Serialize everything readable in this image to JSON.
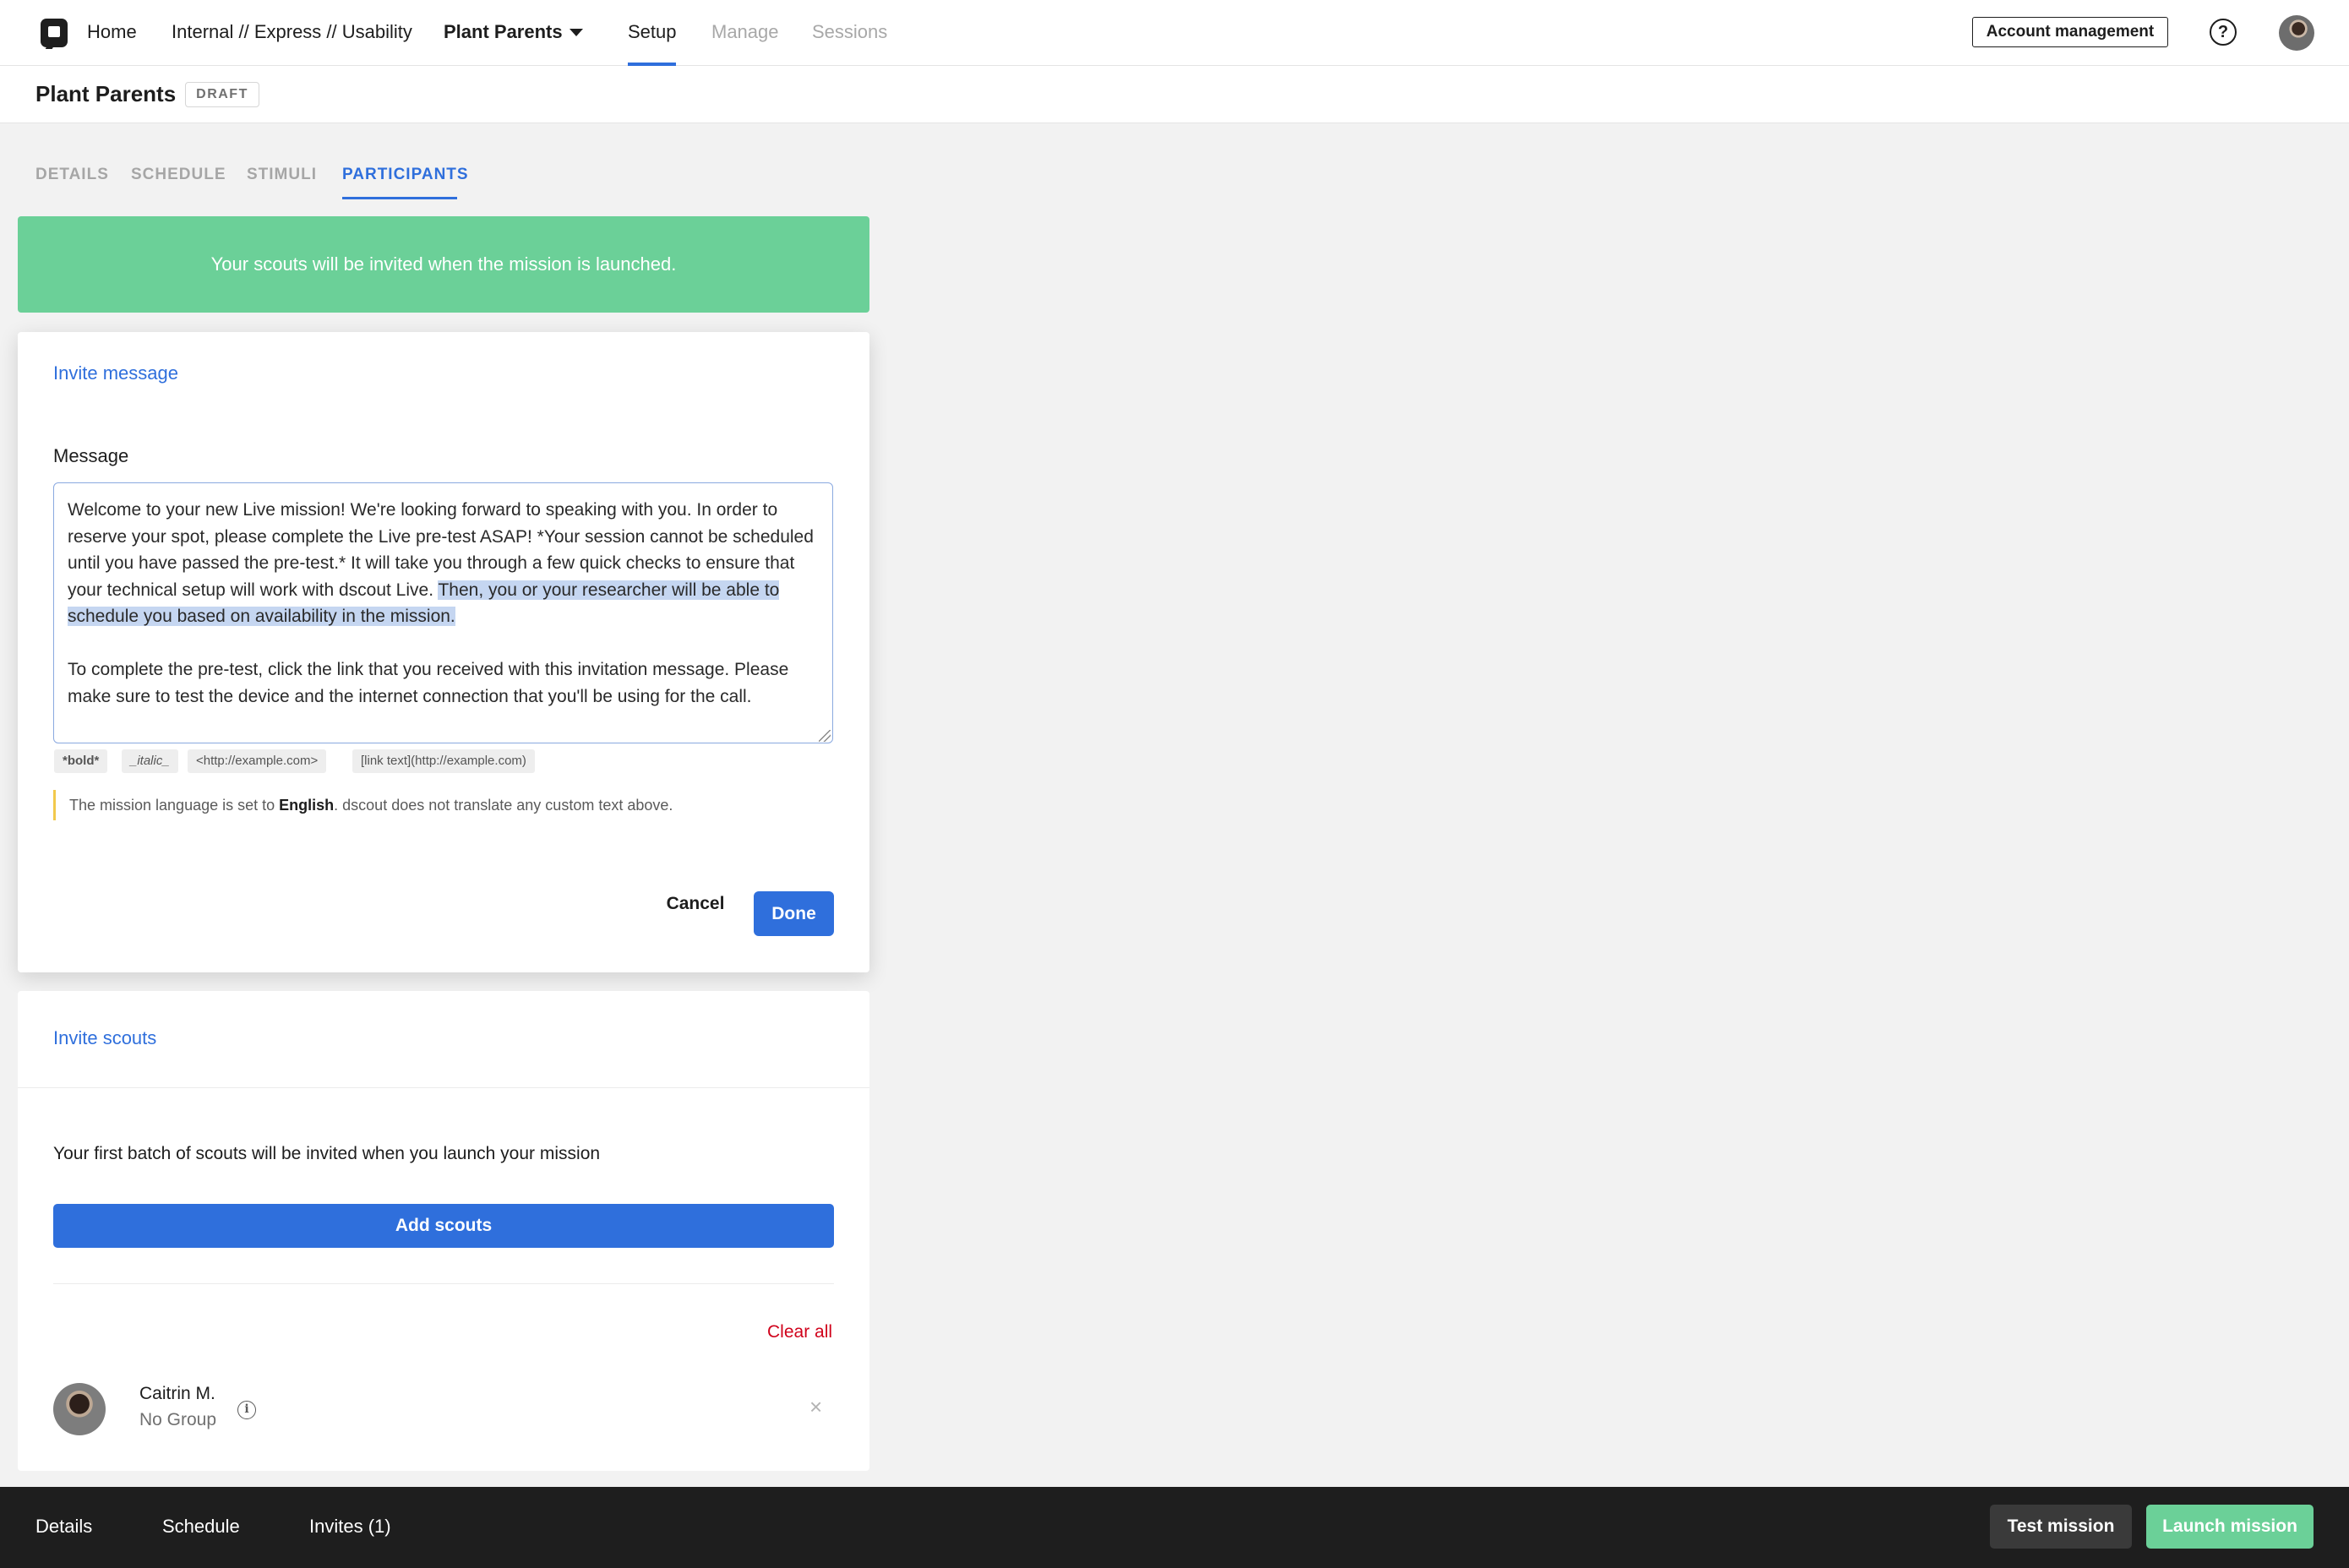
{
  "topnav": {
    "home": "Home",
    "crumb": "Internal // Express // Usability",
    "project": "Plant Parents",
    "tabs": {
      "setup": "Setup",
      "manage": "Manage",
      "sessions": "Sessions"
    },
    "account_button": "Account management",
    "help": "?"
  },
  "mission": {
    "title": "Plant Parents",
    "status": "DRAFT"
  },
  "section_tabs": {
    "details": "DETAILS",
    "schedule": "SCHEDULE",
    "stimuli": "STIMULI",
    "participants": "PARTICIPANTS"
  },
  "banner": {
    "text": "Your scouts will be invited when the mission is launched."
  },
  "invite_message": {
    "title": "Invite message",
    "label": "Message",
    "body_part1": "Welcome to your new Live mission! We're looking forward to speaking with you. In order to reserve your spot, please complete the Live pre-test ASAP! *Your session cannot be scheduled until you have passed the pre-test.* It will take you through a few quick checks to ensure that your technical setup will work with dscout Live. ",
    "body_highlighted": "Then, you or your researcher will be able to schedule you based on availability in the mission.",
    "body_part2": "To complete the pre-test, click the link that you received with this invitation message. Please make sure to test the device and the internet connection that you'll be using for the call.",
    "format_chips": [
      "*bold*",
      "_italic_",
      "<http://example.com>",
      "[link text](http://example.com)"
    ],
    "lang_note_before": "The mission language is set to ",
    "lang_note_language": "English",
    "lang_note_after": ". dscout does not translate any custom text above.",
    "cancel": "Cancel",
    "done": "Done"
  },
  "invite_scouts": {
    "title": "Invite scouts",
    "batch_text": "Your first batch of scouts will be invited when you launch your mission",
    "add_button": "Add scouts",
    "clear_all": "Clear all",
    "scouts": [
      {
        "name": "Caitrin M.",
        "group": "No Group"
      }
    ],
    "remove_glyph": "×",
    "info_glyph": "i"
  },
  "bottom_bar": {
    "details": "Details",
    "schedule": "Schedule",
    "invites": "Invites (1)",
    "test_button": "Test mission",
    "launch_button": "Launch mission"
  },
  "colors": {
    "accent": "#2f6fdc",
    "success": "#6bd098",
    "danger": "#d0021b",
    "bottom_bar": "#1e1e1e"
  }
}
